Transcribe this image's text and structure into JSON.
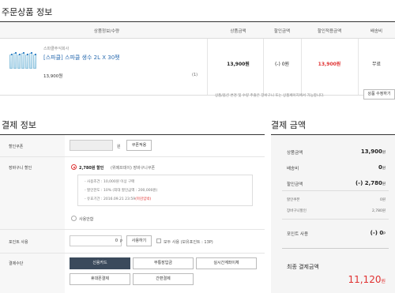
{
  "order_section": {
    "title": "주문상품 정보",
    "headers": {
      "product": "상품정보/수량",
      "price": "상품금액",
      "discount": "할인금액",
      "final": "할인적용금액",
      "shipping": "배송비"
    },
    "item": {
      "seller": "스파클주식회사",
      "name": "[스파클] 스파클 생수 2L X 30펫",
      "unit_price": "13,900원",
      "qty": "(1)",
      "price": "13,900원",
      "discount": "(-) 0원",
      "final": "13,900원",
      "shipping": "무료"
    },
    "note": "상품/옵션 변경 및 수량 추출은 장바구니 또는 상품페이지에서 가능합니다.",
    "option_button": "상품 수정하기"
  },
  "payment_section": {
    "title": "결제 정보",
    "coupon": {
      "label": "할인쿠폰",
      "unit": "원",
      "button": "쿠폰적용"
    },
    "cart_discount": {
      "label": "장바구니 할인",
      "option_text": "2,780원 할인",
      "option_sub": "(위메프데이) 장바구니쿠폰",
      "details": [
        "- 사용조건 : 10,000원 이상 구매",
        "- 할인한도 : 10% (최대 할인금액 : 200,000원)",
        "- 유효기간 : 2016.09.21 23:59"
      ],
      "deadline": "(마감임박)",
      "no_use": "사용안함"
    },
    "points": {
      "label": "포인트 사용",
      "value": "0",
      "unit": "P",
      "button": "사용하기",
      "all_use": "모두 사용 (보유포인트 : 13P)"
    },
    "method": {
      "label": "결제수단",
      "options": [
        "신용카드",
        "무통장입금",
        "실시간계좌이체",
        "휴대폰결제",
        "간편결제"
      ]
    }
  },
  "summary_section": {
    "title": "결제 금액",
    "product_price_label": "상품금액",
    "product_price": "13,900",
    "shipping_label": "배송비",
    "shipping": "0",
    "discount_label": "할인금액",
    "discount": "(-) 2,780",
    "coupon_label": "할인쿠폰",
    "coupon": "0원",
    "cart_label": "장바구니할인",
    "cart": "2,780원",
    "points_label": "포인트 사용",
    "points": "(-) 0",
    "final_label": "최종 결제금액",
    "final": "11,120",
    "won": "원",
    "point_unit": "P"
  }
}
